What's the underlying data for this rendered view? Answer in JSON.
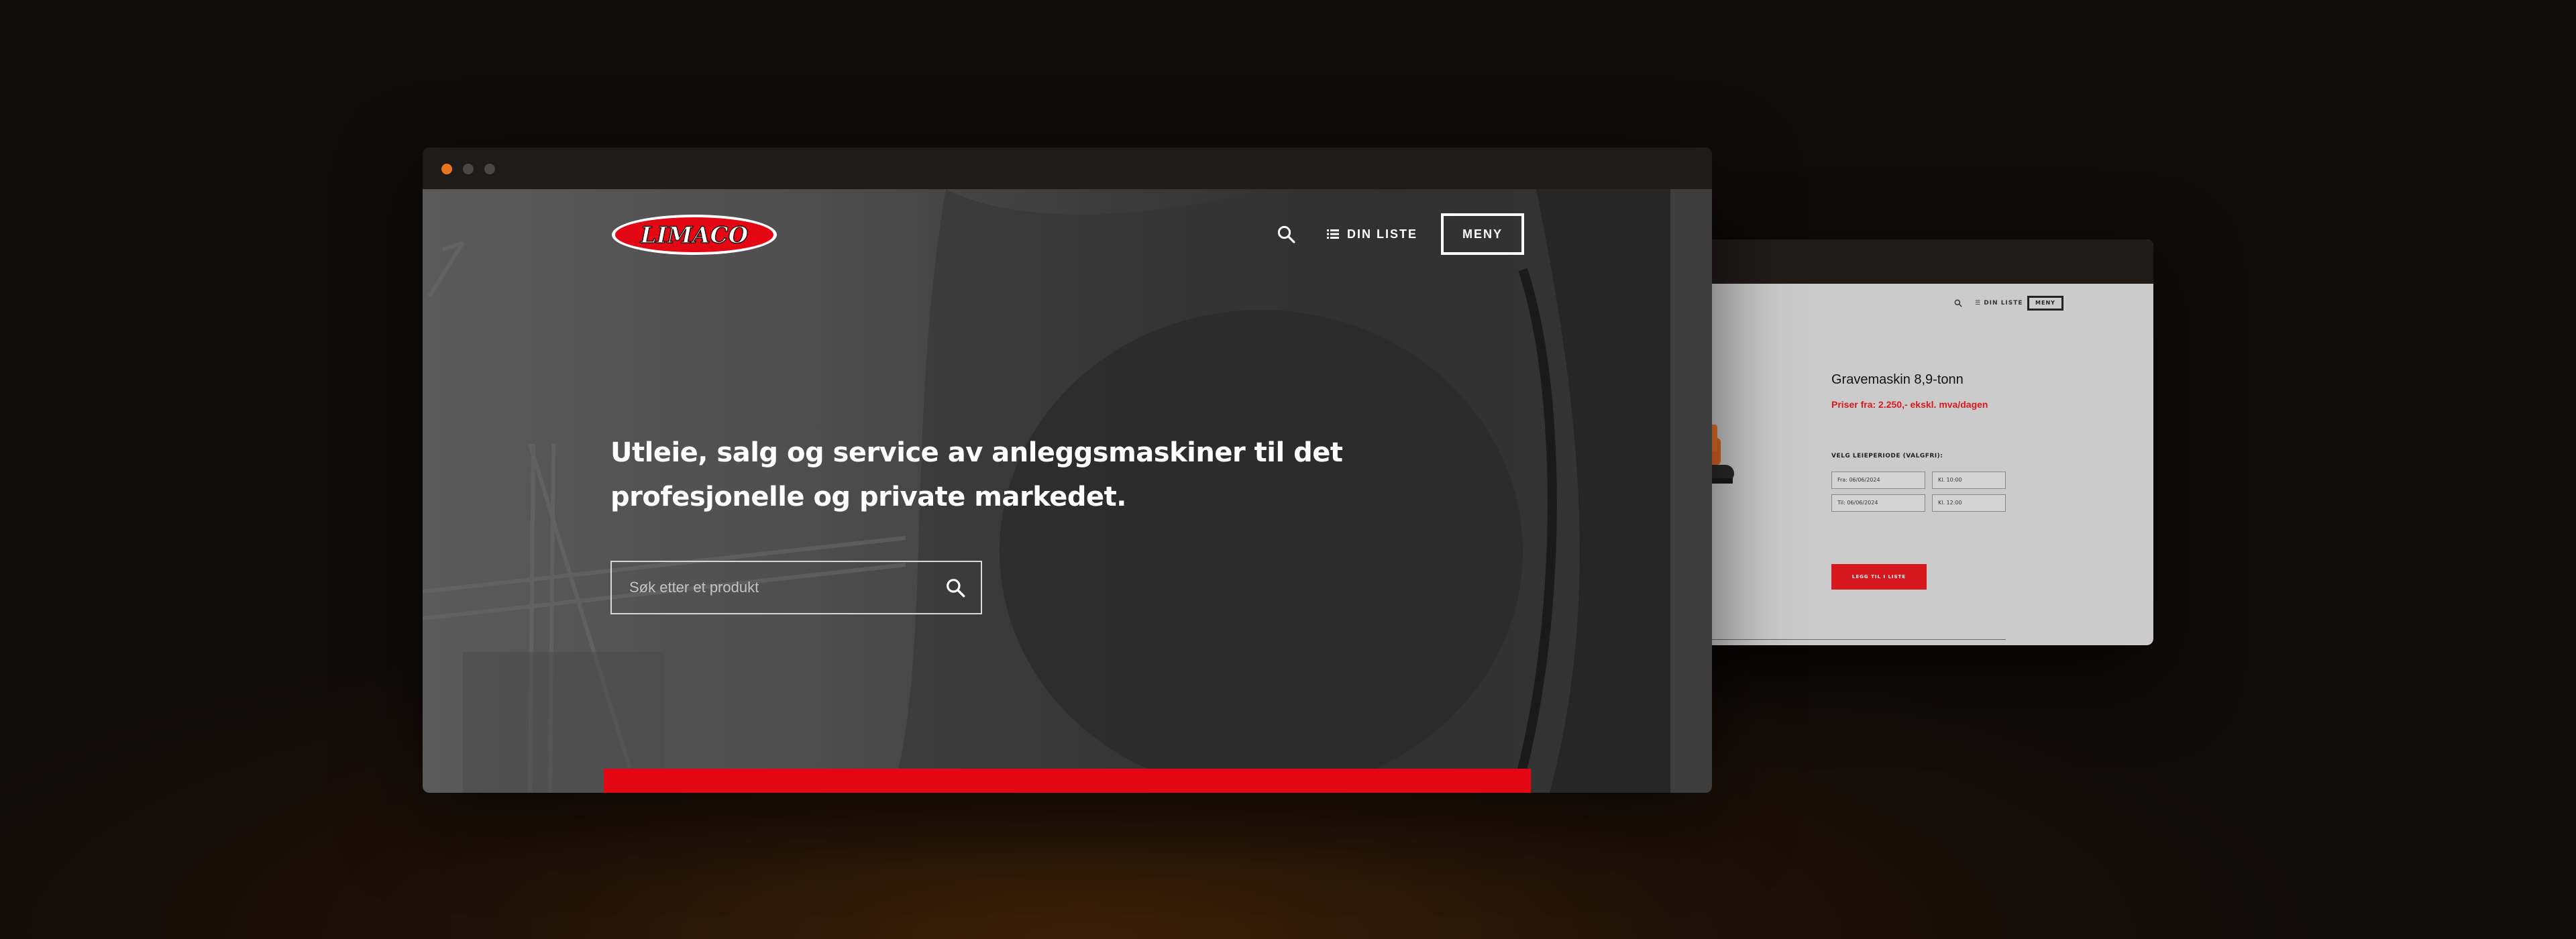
{
  "front_window": {
    "titlebar": {
      "dots": [
        "#e8741c",
        "#4a4644",
        "#4a4644"
      ]
    },
    "header": {
      "logo_text": "LIMACO",
      "search_icon": "search-icon",
      "list_label": "DIN LISTE",
      "list_icon": "list-icon",
      "menu_label": "MENY"
    },
    "hero": {
      "headline": "Utleie, salg og service av anleggsmaskiner til det profesjonelle og private markedet.",
      "search_placeholder": "Søk etter et produkt",
      "search_icon": "search-icon"
    },
    "colors": {
      "brand_red": "#e30613",
      "hero_text": "#ffffff"
    }
  },
  "back_window": {
    "header": {
      "list_label": "DIN LISTE",
      "menu_label": "MENY"
    },
    "product": {
      "title": "Gravemaskin 8,9-tonn",
      "price": "Priser fra: 2.250,- ekskl. mva/dagen",
      "period_label": "VELG LEIEPERIODE (VALGFRI):",
      "from_date": "Fra: 06/06/2024",
      "from_time": "Kl. 10:00",
      "to_date": "Til: 06/06/2024",
      "to_time": "Kl. 12:00",
      "add_button": "LEGG TIL I LISTE"
    }
  }
}
